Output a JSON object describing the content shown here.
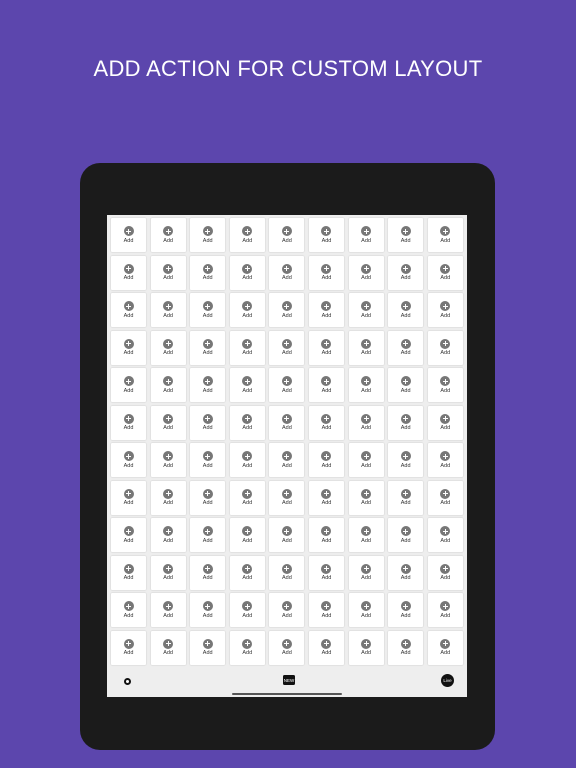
{
  "headline": "ADD ACTION FOR CUSTOM LAYOUT",
  "grid": {
    "rows": 12,
    "columns": 9,
    "cell_label": "Add",
    "cell_icon": "add-circle-icon",
    "icon_color": "#777777"
  },
  "bottom_bar": {
    "settings_icon": "gear-icon",
    "new_label": "NEW",
    "live_label": "Live"
  },
  "colors": {
    "background": "#5c46ad",
    "device": "#1b1b1b",
    "screen": "#eeeeee",
    "cell": "#ffffff"
  }
}
